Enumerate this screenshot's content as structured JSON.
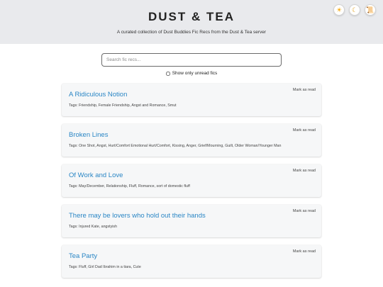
{
  "header": {
    "title": "DUST & TEA",
    "subtitle": "A curated collection of Dust Buddies Fic Recs from the Dust & Tea server",
    "buttons": [
      {
        "icon": "sun-icon",
        "glyph": "☀"
      },
      {
        "icon": "moon-icon",
        "glyph": "☾"
      },
      {
        "icon": "scroll-icon",
        "glyph": "📜"
      }
    ]
  },
  "search": {
    "placeholder": "Search fic recs...",
    "value": ""
  },
  "filter": {
    "label": "Show only unread fics",
    "checked": false
  },
  "fics": [
    {
      "title": "A Ridiculous Notion",
      "mark_label": "Mark as read",
      "tags": "Tags: Friendship, Female Friendship, Angst and Romance, Smut"
    },
    {
      "title": "Broken Lines",
      "mark_label": "Mark as read",
      "tags": "Tags: One Shot, Angst, Hurt/Comfort Emotional Hurt/Comfort, Kissing, Anger, Grief/Mourning, Guilt, Older Woman/Younger Man"
    },
    {
      "title": "Of Work and Love",
      "mark_label": "Mark as read",
      "tags": "Tags: May/December, Relationship, Fluff, Romance, sort of domestic fluff"
    },
    {
      "title": "There may be lovers who hold out their hands",
      "mark_label": "Mark as read",
      "tags": "Tags: Injured Kate, angstyish"
    },
    {
      "title": "Tea Party",
      "mark_label": "Mark as read",
      "tags": "Tags: Fluff, Girl Dad Ibrahim in a tiara, Cute"
    }
  ],
  "colors": {
    "header_bg": "#e9eaed",
    "title_link": "#2a86c5",
    "card_bg": "#f6f7f8"
  }
}
